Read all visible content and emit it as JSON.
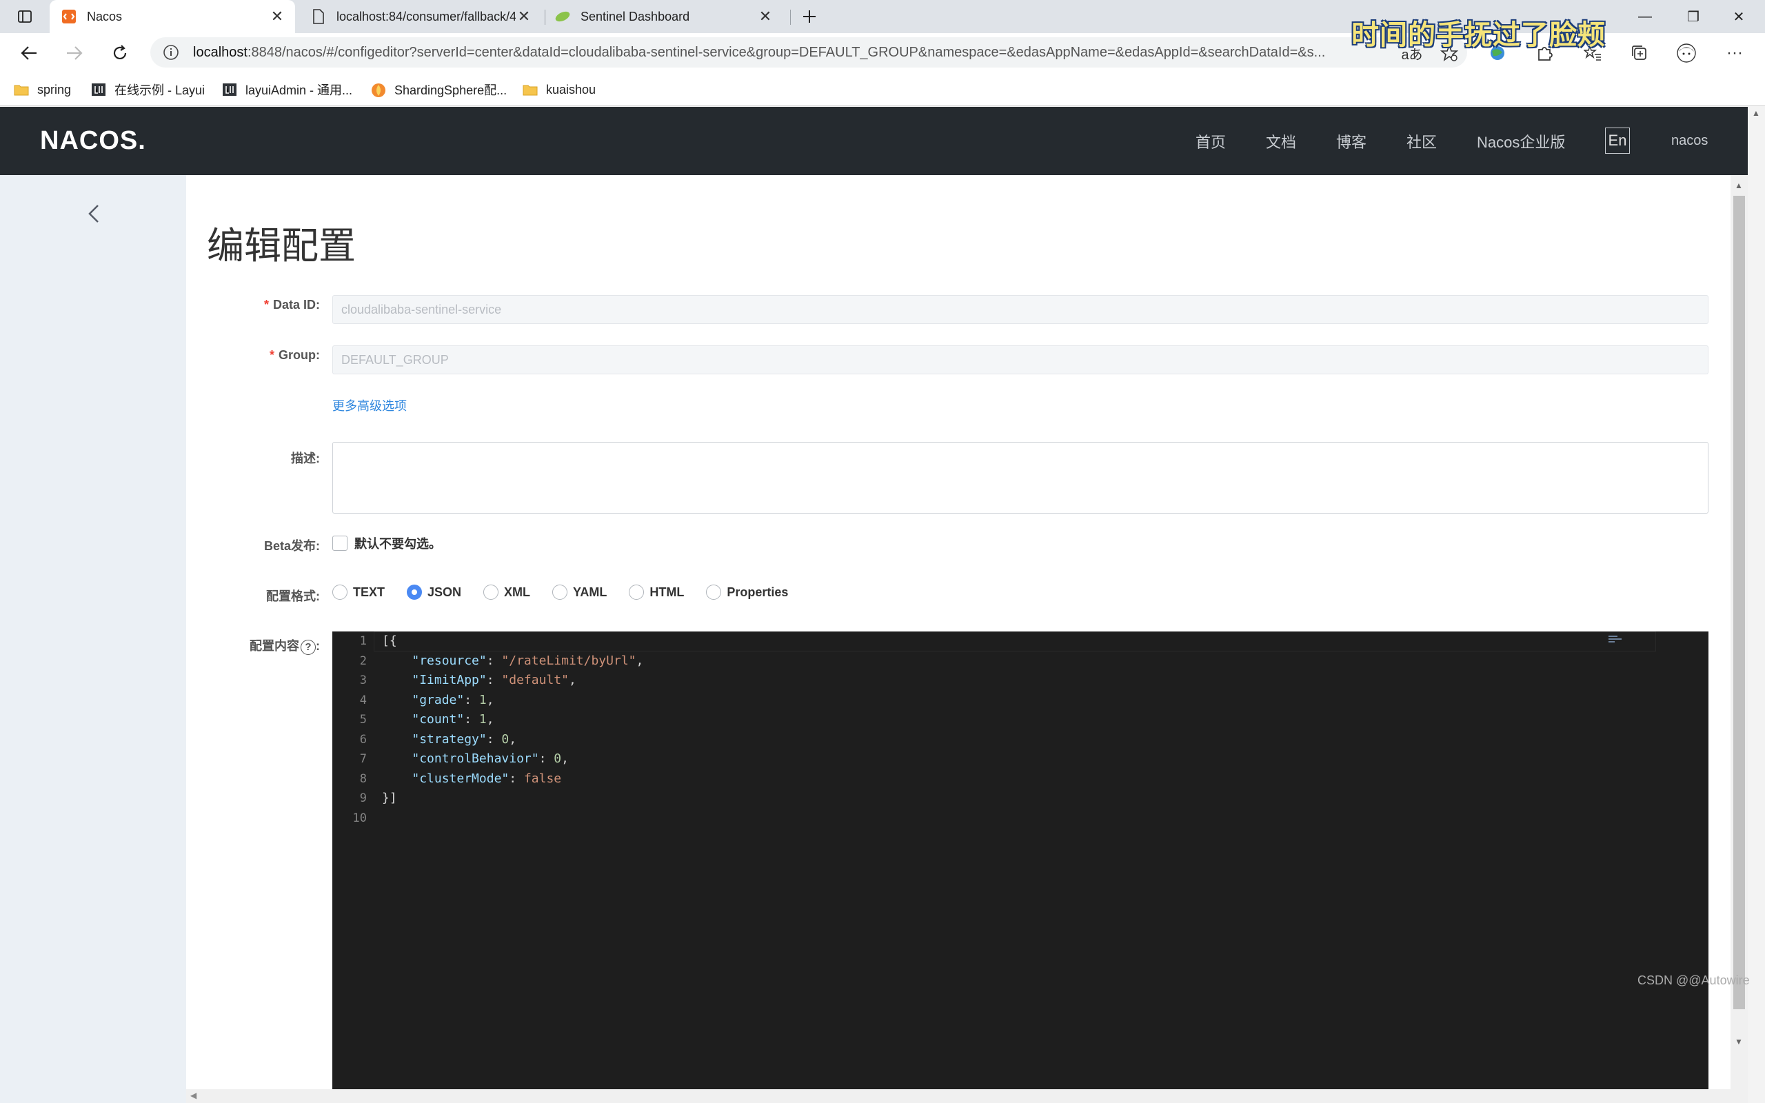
{
  "browser": {
    "tabs": [
      {
        "title": "Nacos",
        "icon": "nacos-favicon"
      },
      {
        "title": "localhost:84/consumer/fallback/4",
        "icon": "page-icon"
      },
      {
        "title": "Sentinel Dashboard",
        "icon": "leaf-icon"
      }
    ],
    "address": {
      "host": "localhost",
      "rest": ":8848/nacos/#/configeditor?serverId=center&dataId=cloudalibaba-sentinel-service&group=DEFAULT_GROUP&namespace=&edasAppName=&edasAppId=&searchDataId=&s..."
    },
    "bookmarks": [
      "spring",
      "在线示例 - Layui",
      "layuiAdmin - 通用...",
      "ShardingSphere配...",
      "kuaishou"
    ],
    "overlay_text": "时间的手抚过了脸颊"
  },
  "nacos": {
    "logo": "NACOS.",
    "nav": [
      "首页",
      "文档",
      "博客",
      "社区",
      "Nacos企业版"
    ],
    "lang": "En",
    "user": "nacos"
  },
  "form": {
    "title": "编辑配置",
    "dataid_label": "Data ID:",
    "dataid_value": "cloudalibaba-sentinel-service",
    "group_label": "Group:",
    "group_value": "DEFAULT_GROUP",
    "advanced_link": "更多高级选项",
    "desc_label": "描述:",
    "beta_label": "Beta发布:",
    "beta_checkbox": "默认不要勾选。",
    "format_label": "配置格式:",
    "formats": [
      "TEXT",
      "JSON",
      "XML",
      "YAML",
      "HTML",
      "Properties"
    ],
    "selected_format": "JSON",
    "content_label": "配置内容",
    "help_glyph": "?"
  },
  "editor": {
    "line_numbers": [
      "1",
      "2",
      "3",
      "4",
      "5",
      "6",
      "7",
      "8",
      "9",
      "10"
    ],
    "lines": [
      "[{",
      "    \"resource\": \"/rateLimit/byUrl\",",
      "    \"IimitApp\": \"default\",",
      "    \"grade\": 1,",
      "    \"count\": 1,",
      "    \"strategy\": 0,",
      "    \"controlBehavior\": 0,",
      "    \"clusterMode\": false",
      "}]",
      ""
    ]
  },
  "watermark": "CSDN @@Autowire"
}
